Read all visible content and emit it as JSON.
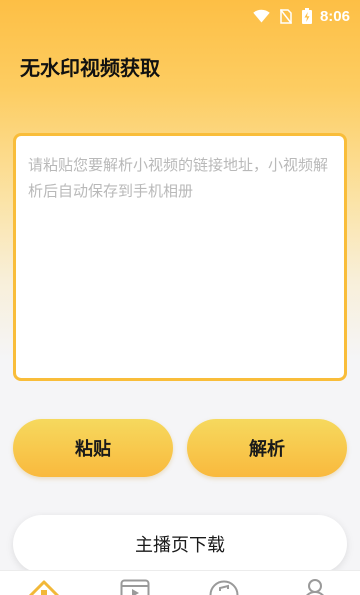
{
  "status_bar": {
    "time": "8:06",
    "icons": [
      "wifi-icon",
      "no-sim-icon",
      "battery-charging-icon"
    ]
  },
  "page": {
    "title": "无水印视频获取"
  },
  "input": {
    "placeholder": "请粘贴您要解析小视频的链接地址，小视频解析后自动保存到手机相册",
    "value": ""
  },
  "buttons": {
    "paste_label": "粘贴",
    "parse_label": "解析",
    "host_download_label": "主播页下载"
  },
  "tab_bar": {
    "tabs": [
      {
        "icon": "home-icon",
        "active": true
      },
      {
        "icon": "video-icon",
        "active": false
      },
      {
        "icon": "music-icon",
        "active": false
      },
      {
        "icon": "user-icon",
        "active": false
      }
    ]
  },
  "colors": {
    "accent": "#f9bd3a",
    "header_gradient_top": "#fdbf45",
    "button_gradient_top": "#f6d95e",
    "button_gradient_bottom": "#f9b93d"
  }
}
